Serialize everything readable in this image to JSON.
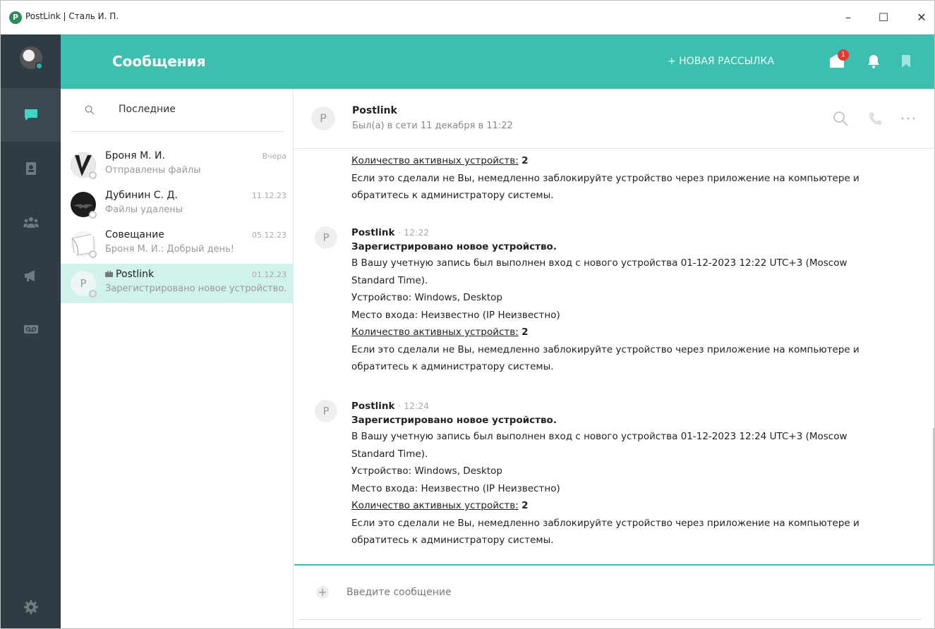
{
  "window": {
    "app_name": "PostLink",
    "separator": "|",
    "user": "Сталь И. П.",
    "controls": {
      "minimize": "–",
      "maximize": "☐",
      "close": "✕"
    }
  },
  "header": {
    "title": "Сообщения",
    "new_mailing": "+ НОВАЯ РАССЫЛКА",
    "notification_count": "1",
    "accent_color": "#3cbfae"
  },
  "rail": {
    "items": [
      "chat-icon",
      "contacts-icon",
      "group-icon",
      "megaphone-icon",
      "voicemail-icon"
    ],
    "settings": "gear-icon"
  },
  "chatlist": {
    "search_label": "Последние",
    "items": [
      {
        "name": "Броня М. И.",
        "date": "Вчера",
        "preview": "Отправлены файлы"
      },
      {
        "name": "Дубинин С. Д.",
        "date": "11.12.23",
        "preview": "Файлы удалены"
      },
      {
        "name": "Совещание",
        "date": "05.12.23",
        "preview": "Броня М. И.: Добрый день!"
      },
      {
        "name": "Postlink",
        "date": "01.12.23",
        "preview": "Зарегистрировано новое устройство.",
        "avatar_letter": "P"
      }
    ]
  },
  "conversation": {
    "avatar_letter": "P",
    "name": "Postlink",
    "status": "Был(а) в сети 11 декабря в 11:22",
    "tail": {
      "active_label": "Количество активных устройств:",
      "active_count": "2",
      "warning_line1": "Если это сделали не Вы, немедленно заблокируйте устройство через приложение на компьютере и",
      "warning_line2": "обратитесь к администратору системы."
    },
    "messages": [
      {
        "author": "Postlink",
        "sep": "·",
        "time": "12:22",
        "title": "Зарегистрировано новое устройство.",
        "line1": "В Вашу учетную запись был выполнен вход с нового устройства 01-12-2023 12:22 UTC+3 (Moscow",
        "line2": "Standard Time).",
        "device": "Устройство: Windows, Desktop",
        "location": "Место входа: Неизвестно (IP Неизвестно)",
        "active_label": "Количество активных устройств:",
        "active_count": "2",
        "warning_line1": "Если это сделали не Вы, немедленно заблокируйте устройство через приложение на компьютере и",
        "warning_line2": "обратитесь к администратору системы."
      },
      {
        "author": "Postlink",
        "sep": "·",
        "time": "12:24",
        "title": "Зарегистрировано новое устройство.",
        "line1": "В Вашу учетную запись был выполнен вход с нового устройства 01-12-2023 12:24 UTC+3 (Moscow",
        "line2": "Standard Time).",
        "device": "Устройство: Windows, Desktop",
        "location": "Место входа: Неизвестно (IP Неизвестно)",
        "active_label": "Количество активных устройств:",
        "active_count": "2",
        "warning_line1": "Если это сделали не Вы, немедленно заблокируйте устройство через приложение на компьютере и",
        "warning_line2": "обратитесь к администратору системы."
      }
    ]
  },
  "composer": {
    "placeholder": "Введите сообщение"
  }
}
